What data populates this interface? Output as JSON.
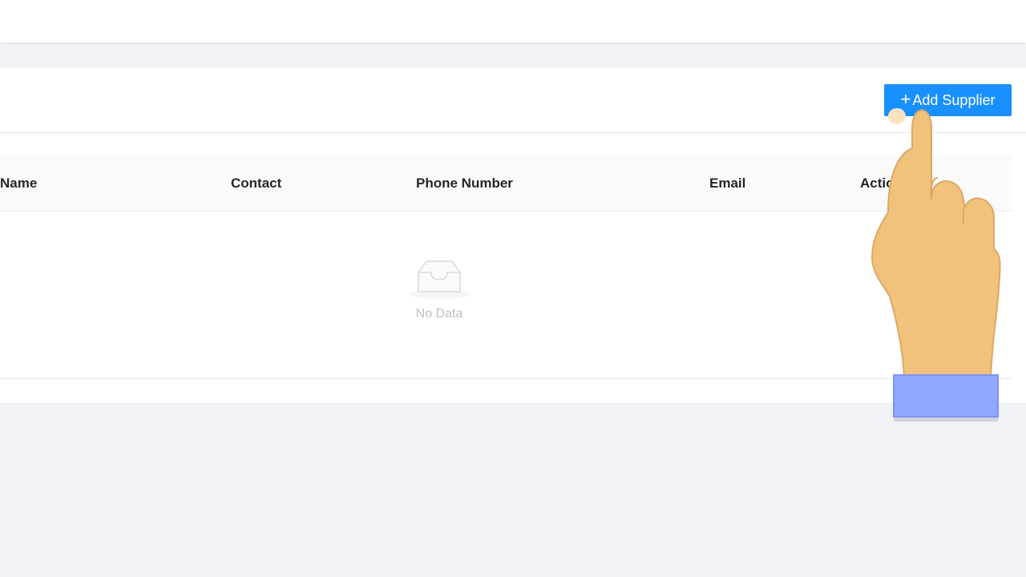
{
  "toolbar": {
    "add_icon": "+",
    "add_label": "Add Supplier"
  },
  "table": {
    "columns": [
      "Name",
      "Contact",
      "Phone Number",
      "Email",
      "Action"
    ],
    "empty_text": "No Data"
  },
  "colors": {
    "primary": "#1890ff",
    "page_bg": "#f0f2f5",
    "cursor_cuff": "#8fa7ff",
    "cursor_skin": "#f0c27b"
  }
}
